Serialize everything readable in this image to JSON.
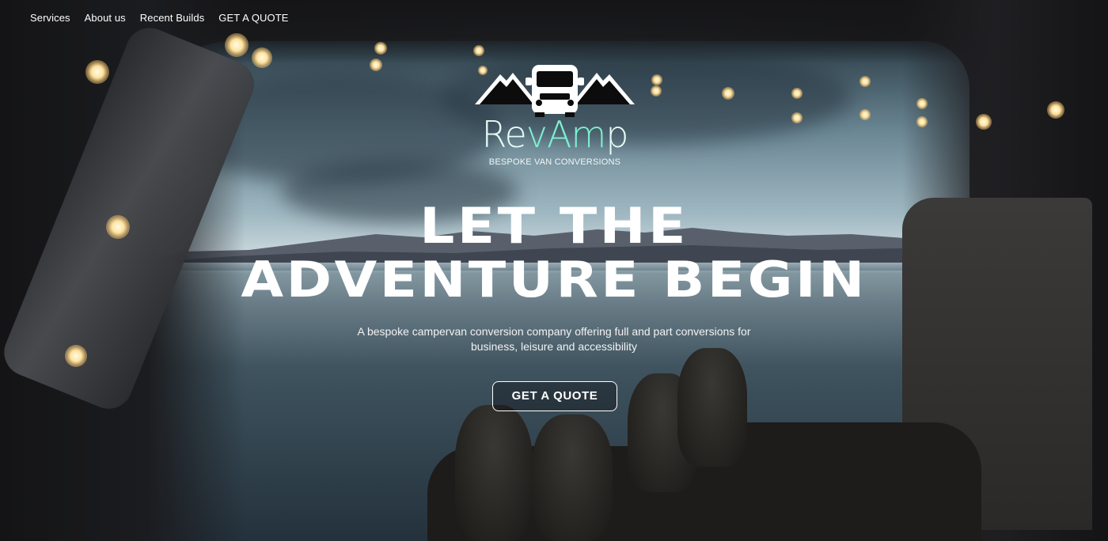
{
  "nav": {
    "items": [
      {
        "label": "Services"
      },
      {
        "label": "About us"
      },
      {
        "label": "Recent Builds"
      },
      {
        "label": "GET A QUOTE"
      }
    ]
  },
  "logo": {
    "word_part1": "Re",
    "word_part2": "vAm",
    "word_part3": "p",
    "tagline": "BESPOKE VAN CONVERSIONS",
    "icon": "van-mountains-icon",
    "accent_color": "#7ef0cf"
  },
  "hero": {
    "headline_line1": "LET THE",
    "headline_line2": "ADVENTURE BEGIN",
    "subtitle": "A bespoke campervan conversion company offering full and part conversions for business, leisure and accessibility",
    "cta_label": "GET A QUOTE"
  }
}
